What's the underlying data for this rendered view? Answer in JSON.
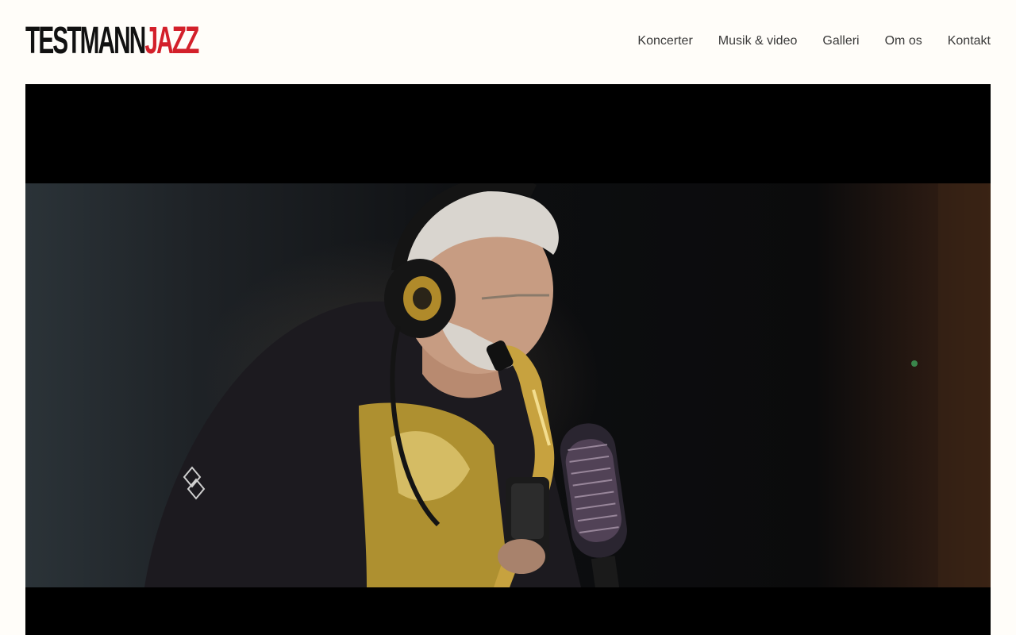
{
  "header": {
    "logo": {
      "main": "TESTMANN",
      "accent": "JAZZ"
    },
    "nav": [
      {
        "label": "Koncerter"
      },
      {
        "label": "Musik & video"
      },
      {
        "label": "Galleri"
      },
      {
        "label": "Om os"
      },
      {
        "label": "Kontakt"
      }
    ]
  },
  "colors": {
    "background": "#fffdf9",
    "logo_text": "#111111",
    "logo_accent": "#d3202a",
    "nav_text": "#3a3a3a",
    "video_letterbox": "#000000"
  },
  "video": {
    "subject": "saxophonist-in-studio"
  }
}
